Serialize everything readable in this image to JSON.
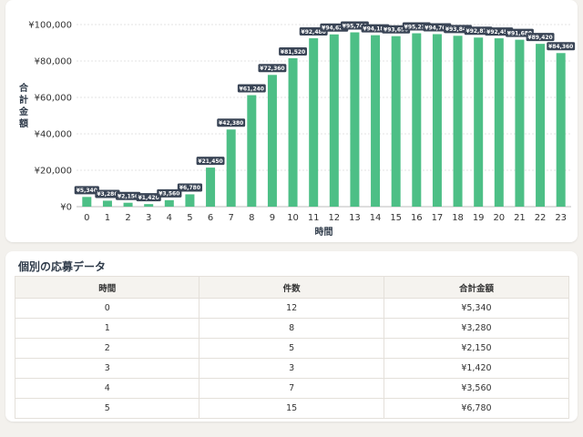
{
  "chart_data": {
    "type": "bar",
    "xlabel": "時間",
    "ylabel": "合計金額",
    "ylim": [
      0,
      100000
    ],
    "yticks": [
      "¥0",
      "¥20,000",
      "¥40,000",
      "¥60,000",
      "¥80,000",
      "¥100,000"
    ],
    "categories": [
      "0",
      "1",
      "2",
      "3",
      "4",
      "5",
      "6",
      "7",
      "8",
      "9",
      "10",
      "11",
      "12",
      "13",
      "14",
      "15",
      "16",
      "17",
      "18",
      "19",
      "20",
      "21",
      "22",
      "23"
    ],
    "values": [
      5340,
      3280,
      2150,
      1420,
      3560,
      6780,
      21450,
      42380,
      61240,
      72360,
      81520,
      92480,
      94620,
      95740,
      94180,
      93650,
      95230,
      94760,
      93840,
      92870,
      92450,
      91680,
      89420,
      84360
    ],
    "data_labels": [
      "¥5,340",
      "¥3,280",
      "¥2,150",
      "¥1,420",
      "¥3,560",
      "¥6,780",
      "¥21,450",
      "¥42,380",
      "¥61,240",
      "¥72,360",
      "¥81,520",
      "¥92,480",
      "¥94,620",
      "¥95,740",
      "¥94,180",
      "¥93,650",
      "¥95,230",
      "¥94,760",
      "¥93,840",
      "¥92,870",
      "¥92,450",
      "¥91,680",
      "¥89,420",
      "¥84,360"
    ],
    "grid": true,
    "bar_color": "#4dbf86",
    "label_bg": "#3a4556"
  },
  "table": {
    "title": "個別の応募データ",
    "headers": [
      "時間",
      "件数",
      "合計金額"
    ],
    "rows": [
      [
        "0",
        "12",
        "¥5,340"
      ],
      [
        "1",
        "8",
        "¥3,280"
      ],
      [
        "2",
        "5",
        "¥2,150"
      ],
      [
        "3",
        "3",
        "¥1,420"
      ],
      [
        "4",
        "7",
        "¥3,560"
      ],
      [
        "5",
        "15",
        "¥6,780"
      ]
    ]
  }
}
